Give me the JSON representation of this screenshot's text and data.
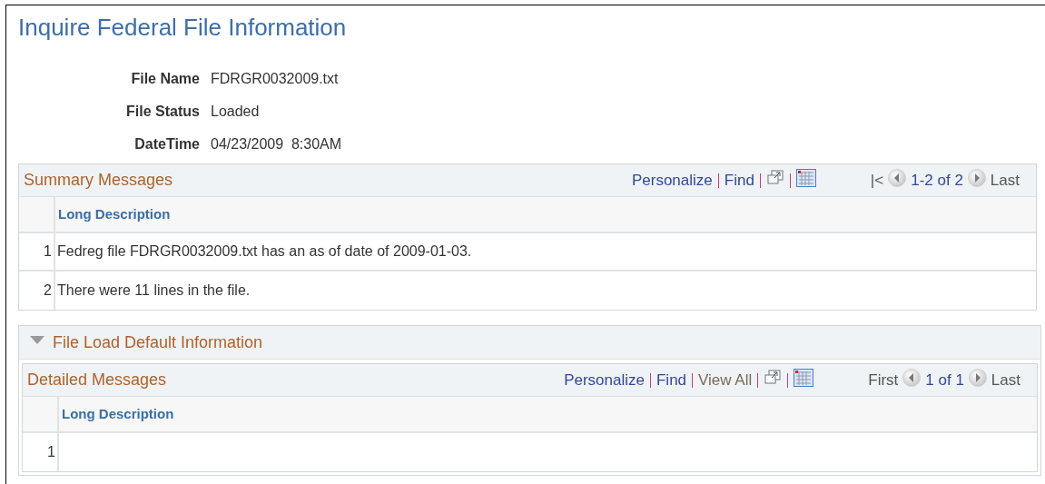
{
  "page": {
    "title": "Inquire Federal File Information"
  },
  "fields": [
    {
      "label": "File Name",
      "value": "FDRGR0032009.txt"
    },
    {
      "label": "File Status",
      "value": "Loaded"
    },
    {
      "label": "DateTime",
      "value": "04/23/2009  8:30AM"
    }
  ],
  "summary_grid": {
    "title": "Summary Messages",
    "toolbar": [
      {
        "kind": "link",
        "label": "Personalize",
        "disabled": false
      },
      {
        "kind": "link",
        "label": "Find",
        "disabled": false
      },
      {
        "kind": "zoom"
      },
      {
        "kind": "download"
      }
    ],
    "pager": {
      "first": "|<",
      "range": "1-2 of 2",
      "last": "Last"
    },
    "columns": [
      "Long Description"
    ],
    "rows": [
      {
        "number": "1",
        "text": "Fedreg file FDRGR0032009.txt has an as of date of 2009-01-03."
      },
      {
        "number": "2",
        "text": "There were 11 lines in the file."
      }
    ]
  },
  "section": {
    "title": "File Load Default Information",
    "expanded": true,
    "grid": {
      "title": "Detailed Messages",
      "toolbar": [
        {
          "kind": "link",
          "label": "Personalize",
          "disabled": false
        },
        {
          "kind": "link",
          "label": "Find",
          "disabled": false
        },
        {
          "kind": "link",
          "label": "View All",
          "disabled": true
        },
        {
          "kind": "zoom"
        },
        {
          "kind": "download"
        }
      ],
      "pager": {
        "first": "First",
        "range": "1 of 1",
        "last": "Last"
      },
      "columns": [
        "Long Description"
      ],
      "rows": [
        {
          "number": "1"
        }
      ]
    }
  }
}
